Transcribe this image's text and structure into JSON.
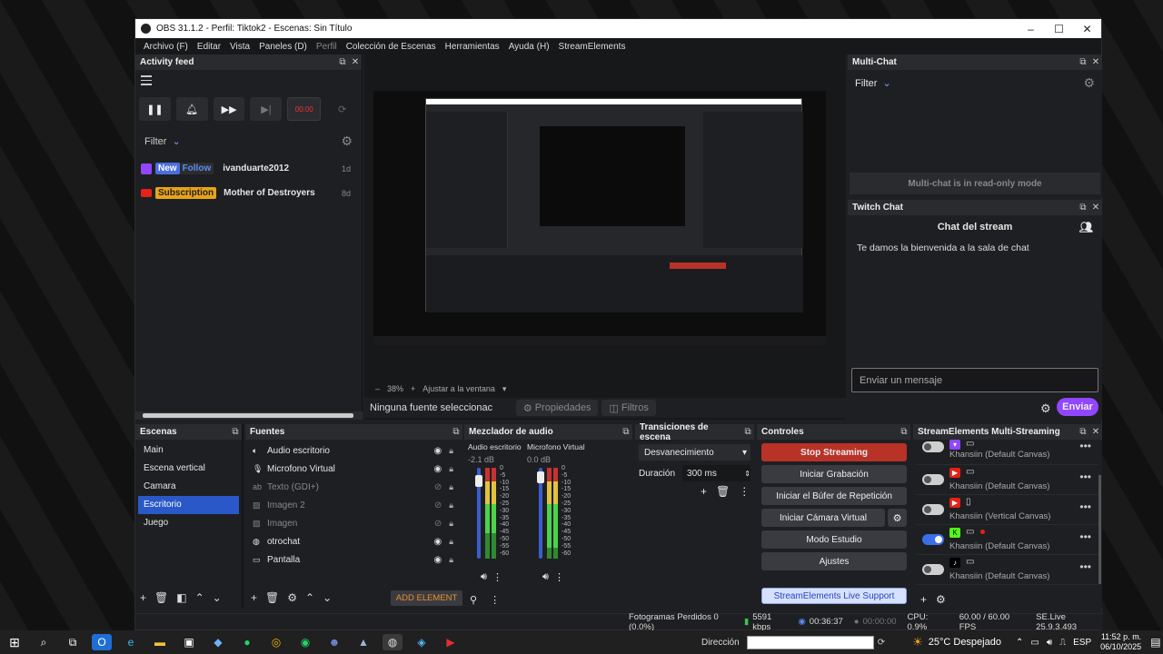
{
  "window": {
    "title": "OBS 31.1.2 - Perfil: Tiktok2 - Escenas: Sin Título",
    "minimize": "–",
    "maximize": "☐",
    "close": "✕"
  },
  "menu": [
    "Archivo (F)",
    "Editar",
    "Vista",
    "Paneles (D)",
    "Perfil",
    "Colección de Escenas",
    "Herramientas",
    "Ayuda (H)",
    "StreamElements"
  ],
  "activity_feed": {
    "title": "Activity feed",
    "timer": "00:00",
    "filter_label": "Filter",
    "items": [
      {
        "platform_icon": "twitch-icon",
        "badge1": "New",
        "badge2": "Follow",
        "name": "ivanduarte2012",
        "age": "1d"
      },
      {
        "platform_icon": "youtube-icon",
        "badge1": "Subscription",
        "name": "Mother of Destroyers",
        "age": "8d"
      }
    ]
  },
  "preview": {
    "zoom": "38%",
    "fit_label": "Ajustar a la ventana",
    "no_source": "Ninguna fuente seleccionac",
    "properties": "Propiedades",
    "filters": "Filtros"
  },
  "multichat": {
    "title": "Multi-Chat",
    "filter_label": "Filter",
    "readonly": "Multi-chat is in read-only mode"
  },
  "twitch_chat": {
    "title": "Twitch Chat",
    "header": "Chat del stream",
    "welcome": "Te damos la bienvenida a la sala de chat",
    "placeholder": "Enviar un mensaje",
    "send": "Enviar"
  },
  "scenes": {
    "title": "Escenas",
    "items": [
      "Main",
      "Escena vertical",
      "Camara",
      "Escritorio",
      "Juego"
    ],
    "selected_index": 3
  },
  "sources": {
    "title": "Fuentes",
    "items": [
      {
        "label": "Audio escritorio",
        "icon": "speaker-icon",
        "dim": false
      },
      {
        "label": "Microfono Virtual",
        "icon": "microphone-icon",
        "dim": false
      },
      {
        "label": "Texto (GDI+)",
        "icon": "text-icon",
        "dim": true
      },
      {
        "label": "Imagen 2",
        "icon": "image-icon",
        "dim": true
      },
      {
        "label": "Imagen",
        "icon": "image-icon",
        "dim": true
      },
      {
        "label": "otrochat",
        "icon": "globe-icon",
        "dim": false
      },
      {
        "label": "Pantalla",
        "icon": "monitor-icon",
        "dim": false
      }
    ],
    "add_element": "ADD ELEMENT"
  },
  "mixer": {
    "title": "Mezclador de audio",
    "channels": [
      {
        "name": "Audio escritorio",
        "db": "-2.1 dB",
        "level": 0.72
      },
      {
        "name": "Microfono Virtual",
        "db": "0.0 dB",
        "level": 0.88
      }
    ],
    "scale": [
      "0",
      "-5",
      "-10",
      "-15",
      "-20",
      "-25",
      "-30",
      "-35",
      "-40",
      "-45",
      "-50",
      "-55",
      "-60"
    ]
  },
  "transitions": {
    "title": "Transiciones de escena",
    "selected": "Desvanecimiento",
    "duration_label": "Duración",
    "duration_value": "300 ms"
  },
  "controls": {
    "title": "Controles",
    "stop_streaming": "Stop Streaming",
    "start_recording": "Iniciar Grabación",
    "replay_buffer": "Iniciar el Búfer de Repetición",
    "virtual_cam": "Iniciar Cámara Virtual",
    "studio_mode": "Modo Estudio",
    "settings": "Ajustes",
    "live_support": "StreamElements Live Support"
  },
  "multistreaming": {
    "title": "StreamElements Multi-Streaming",
    "items": [
      {
        "platform": "twitch-icon",
        "device": "monitor-icon",
        "label": "Khansiin (Default Canvas)",
        "on": false
      },
      {
        "platform": "youtube-icon",
        "device": "monitor-icon",
        "label": "Khansiin (Default Canvas)",
        "on": false
      },
      {
        "platform": "youtube-icon",
        "device": "phone-icon",
        "label": "Khansiin (Vertical Canvas)",
        "on": false
      },
      {
        "platform": "kick-icon",
        "device": "monitor-icon",
        "label": "Khansiin (Default Canvas)",
        "on": true
      },
      {
        "platform": "tiktok-icon",
        "device": "monitor-icon",
        "label": "Khansiin (Default Canvas)",
        "on": false
      }
    ]
  },
  "statusbar": {
    "dropped": "Fotogramas Perdidos 0 (0.0%)",
    "bitrate": "5591 kbps",
    "stream_time": "00:36:37",
    "rec_time": "00:00:00",
    "cpu": "CPU: 0.9%",
    "fps": "60.00 / 60.00 FPS",
    "se_version": "SE.Live 25.9.3.493"
  },
  "taskbar": {
    "address_label": "Dirección",
    "weather": "25°C  Despejado",
    "lang": "ESP",
    "time": "11:52 p. m.",
    "date": "06/10/2025"
  },
  "colors": {
    "selected_blue": "#2a58c8",
    "stop_red": "#b83228",
    "enviar_purple": "#9146ff",
    "twitch_purple": "#9146ff",
    "youtube_red": "#e62117",
    "kick_green": "#53fc18"
  }
}
